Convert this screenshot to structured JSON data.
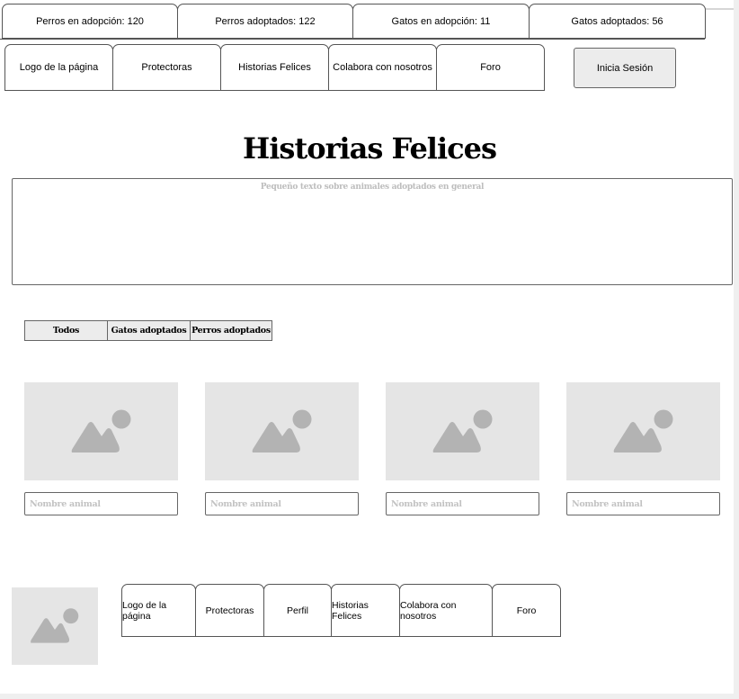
{
  "stats": {
    "dogs_for_adoption": "Perros en adopción: 120",
    "dogs_adopted": "Perros adoptados: 122",
    "cats_for_adoption": "Gatos en adopción: 11",
    "cats_adopted": "Gatos adoptados: 56"
  },
  "nav": {
    "items": [
      {
        "label": "Logo de la página"
      },
      {
        "label": "Protectoras"
      },
      {
        "label": "Historias Felices"
      },
      {
        "label": "Colabora con nosotros"
      },
      {
        "label": "Foro"
      }
    ],
    "login_label": "Inicia Sesión"
  },
  "main": {
    "title": "Historias Felices",
    "intro_text": "Pequeño texto sobre animales adoptados en general",
    "filters": [
      {
        "label": "Todos"
      },
      {
        "label": "Gatos adoptados"
      },
      {
        "label": "Perros adoptados"
      }
    ],
    "cards": [
      {
        "name_placeholder": "Nombre animal",
        "icon": "image-placeholder-icon"
      },
      {
        "name_placeholder": "Nombre animal",
        "icon": "image-placeholder-icon"
      },
      {
        "name_placeholder": "Nombre animal",
        "icon": "image-placeholder-icon"
      },
      {
        "name_placeholder": "Nombre animal",
        "icon": "image-placeholder-icon"
      }
    ]
  },
  "footer": {
    "logo_icon": "image-placeholder-icon",
    "items": [
      {
        "label": "Logo de la página"
      },
      {
        "label": "Protectoras"
      },
      {
        "label": "Perfil"
      },
      {
        "label": "Historias Felices"
      },
      {
        "label": "Colabora con nosotros"
      },
      {
        "label": "Foro"
      }
    ]
  },
  "colors": {
    "placeholder_bg": "#e5e5e5",
    "placeholder_icon": "#b3b3b3",
    "button_bg": "#ececec",
    "muted_text": "#bdbdbd"
  }
}
